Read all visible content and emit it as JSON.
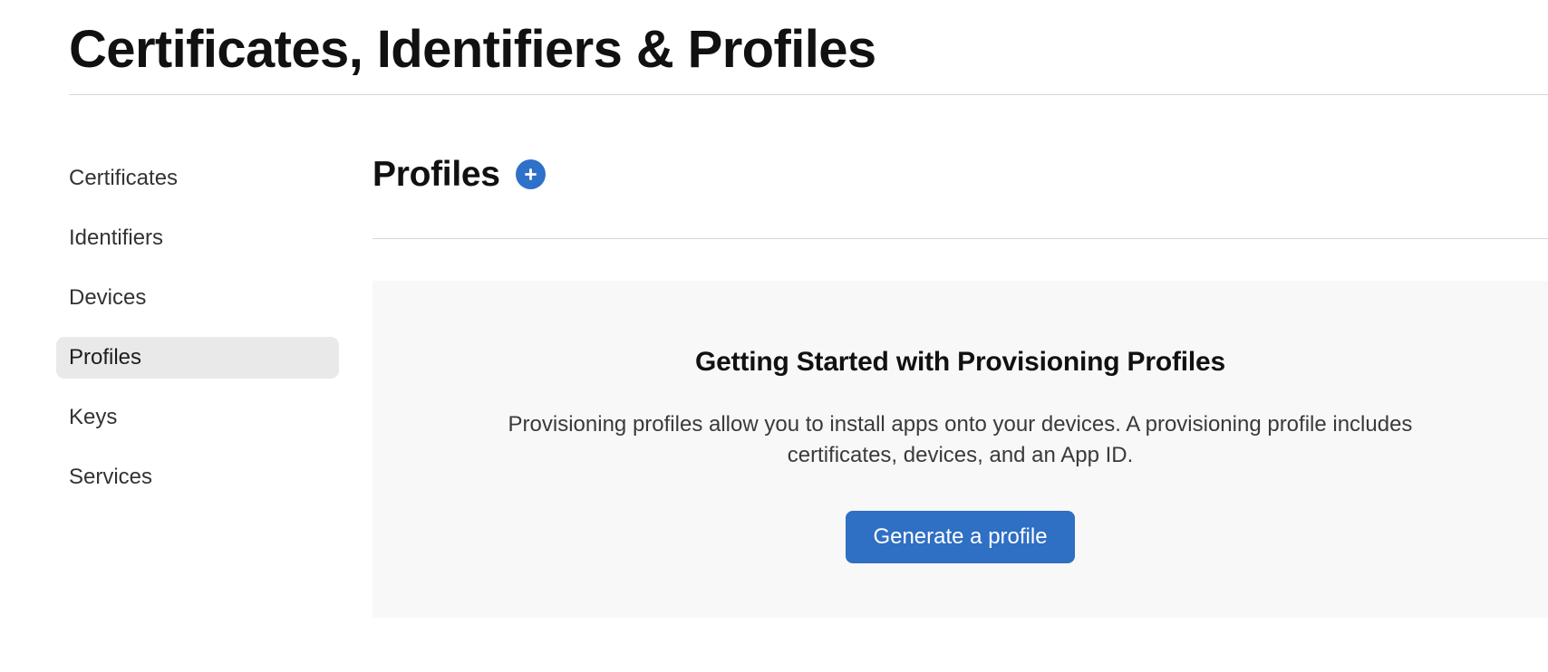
{
  "header": {
    "title": "Certificates, Identifiers & Profiles"
  },
  "sidebar": {
    "items": [
      {
        "label": "Certificates",
        "active": false
      },
      {
        "label": "Identifiers",
        "active": false
      },
      {
        "label": "Devices",
        "active": false
      },
      {
        "label": "Profiles",
        "active": true
      },
      {
        "label": "Keys",
        "active": false
      },
      {
        "label": "Services",
        "active": false
      }
    ]
  },
  "main": {
    "section_title": "Profiles",
    "add_button_label": "+",
    "getting_started": {
      "title": "Getting Started with Provisioning Profiles",
      "body": "Provisioning profiles allow you to install apps onto your devices. A provisioning profile includes certificates, devices, and an App ID.",
      "cta_label": "Generate a profile"
    }
  },
  "colors": {
    "accent_blue": "#2f71c9",
    "button_blue": "#2f6fc4",
    "card_background": "#f8f8f8",
    "active_nav_background": "#e9e9ea",
    "rule": "#d8d8dc"
  }
}
